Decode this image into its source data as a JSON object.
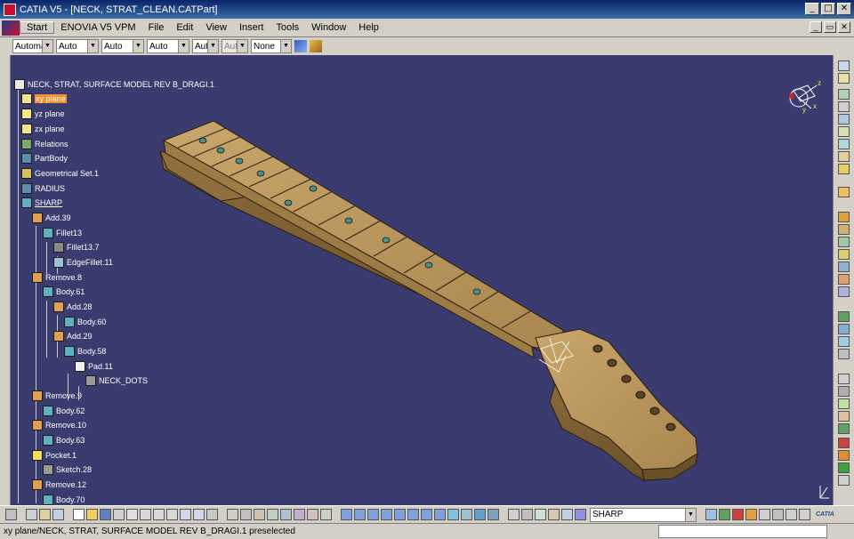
{
  "window": {
    "title": "CATIA V5 - [NECK, STRAT_CLEAN.CATPart]",
    "controls": {
      "minimize": "_",
      "maximize": "□",
      "close": "✕"
    }
  },
  "menu": {
    "items": [
      "Start",
      "ENOVIA V5 VPM",
      "File",
      "Edit",
      "View",
      "Insert",
      "Tools",
      "Window",
      "Help"
    ],
    "doc_controls": {
      "minimize": "_",
      "restore": "▭",
      "close": "✕"
    }
  },
  "graphic_properties": {
    "combos": [
      {
        "value": "Automa",
        "disabled": false
      },
      {
        "value": "Auto",
        "disabled": false
      },
      {
        "value": "Auto",
        "disabled": false
      },
      {
        "value": "Auto",
        "disabled": false
      },
      {
        "value": "Aut",
        "disabled": false
      },
      {
        "value": "Aut",
        "disabled": true
      },
      {
        "value": "None",
        "disabled": false
      }
    ]
  },
  "tree": {
    "root": "NECK, STRAT, SURFACE MODEL REV B_DRAGI.1",
    "nodes": [
      {
        "label": "xy plane",
        "selected": true
      },
      {
        "label": "yz plane"
      },
      {
        "label": "zx plane"
      },
      {
        "label": "Relations"
      },
      {
        "label": "PartBody"
      },
      {
        "label": "Geometrical Set.1"
      },
      {
        "label": "RADIUS"
      },
      {
        "label": "SHARP",
        "underline": true
      },
      {
        "label": "Add.39"
      },
      {
        "label": "Fillet13"
      },
      {
        "label": "Fillet13.7"
      },
      {
        "label": "EdgeFillet.11"
      },
      {
        "label": "Remove.8"
      },
      {
        "label": "Body.61"
      },
      {
        "label": "Add.28"
      },
      {
        "label": "Body.60"
      },
      {
        "label": "Add.29"
      },
      {
        "label": "Body.58"
      },
      {
        "label": "Pad.11"
      },
      {
        "label": "NECK_DOTS"
      },
      {
        "label": "Remove.9"
      },
      {
        "label": "Body.62"
      },
      {
        "label": "Remove.10"
      },
      {
        "label": "Body.63"
      },
      {
        "label": "Pocket.1"
      },
      {
        "label": "Sketch.28"
      },
      {
        "label": "Remove.12"
      },
      {
        "label": "Body.70"
      }
    ]
  },
  "compass": {
    "axis_labels": [
      "x",
      "y",
      "z"
    ]
  },
  "current_body_selector": {
    "value": "SHARP"
  },
  "status": {
    "text": "xy plane/NECK, STRAT, SURFACE MODEL REV B_DRAGI.1 preselected"
  },
  "brand": {
    "logo_text": "CATIA"
  },
  "colors": {
    "viewport_bg": "#3a3b6e",
    "neck_wood": "#b8955c",
    "neck_dark": "#5a4428",
    "selection": "#f29130",
    "title_bar": "#0a246a"
  }
}
